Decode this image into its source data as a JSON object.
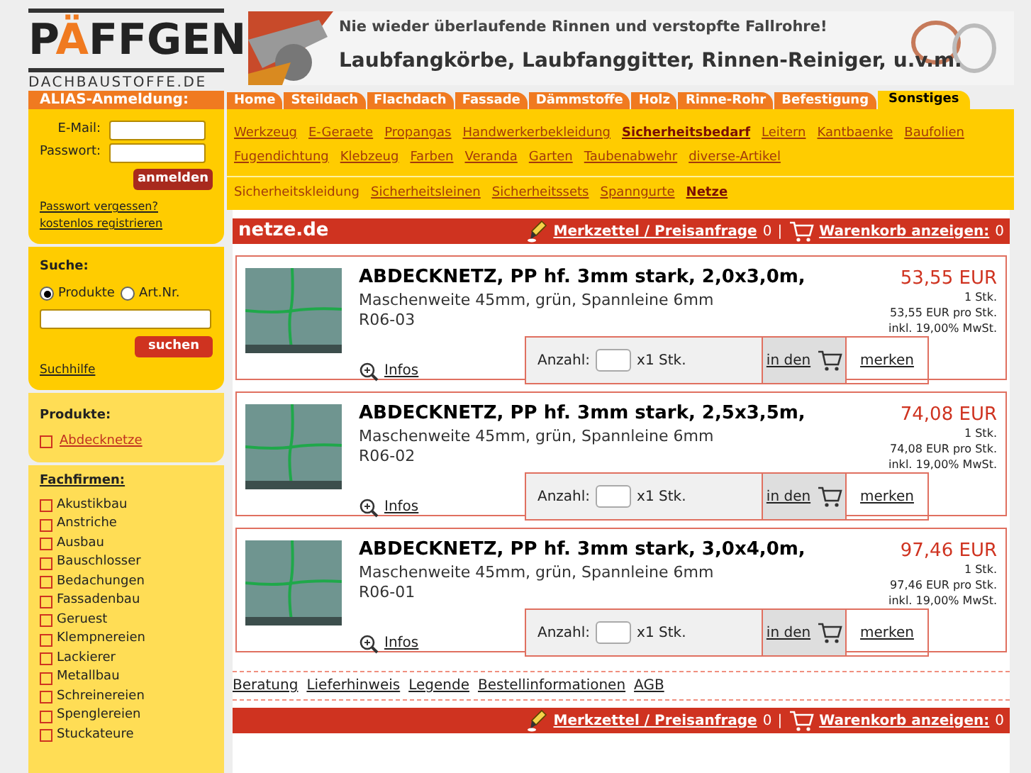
{
  "logo": {
    "before": "P",
    "accent": "Ä",
    "after": "FFGEN",
    "subtitle": "DACHBAUSTOFFE.DE"
  },
  "banner": {
    "headline": "Nie wieder überlaufende Rinnen und verstopfte Fallrohre!",
    "tagline": "Laubfangkörbe, Laubfanggitter, Rinnen-Reiniger, u.v.m."
  },
  "tabs": [
    {
      "label": "Home",
      "selected": false
    },
    {
      "label": "Steildach",
      "selected": false
    },
    {
      "label": "Flachdach",
      "selected": false
    },
    {
      "label": "Fassade",
      "selected": false
    },
    {
      "label": "Dämmstoffe",
      "selected": false
    },
    {
      "label": "Holz",
      "selected": false
    },
    {
      "label": "Rinne-Rohr",
      "selected": false
    },
    {
      "label": "Befestigung",
      "selected": false
    },
    {
      "label": "Sonstiges",
      "selected": true
    }
  ],
  "categories": [
    {
      "label": "Werkzeug",
      "selected": false
    },
    {
      "label": "E-Geraete",
      "selected": false
    },
    {
      "label": "Propangas",
      "selected": false
    },
    {
      "label": "Handwerkerbekleidung",
      "selected": false
    },
    {
      "label": "Sicherheitsbedarf",
      "selected": true
    },
    {
      "label": "Leitern",
      "selected": false
    },
    {
      "label": "Kantbaenke",
      "selected": false
    },
    {
      "label": "Baufolien",
      "selected": false
    },
    {
      "label": "Fugendichtung",
      "selected": false
    },
    {
      "label": "Klebzeug",
      "selected": false
    },
    {
      "label": "Farben",
      "selected": false
    },
    {
      "label": "Veranda",
      "selected": false
    },
    {
      "label": "Garten",
      "selected": false
    },
    {
      "label": "Taubenabwehr",
      "selected": false
    },
    {
      "label": "diverse-Artikel",
      "selected": false
    }
  ],
  "subcategories": [
    {
      "label": "Sicherheitskleidung",
      "kind": "text",
      "selected": false
    },
    {
      "label": "Sicherheitsleinen",
      "kind": "link",
      "selected": false
    },
    {
      "label": "Sicherheitssets",
      "kind": "link",
      "selected": false
    },
    {
      "label": "Spanngurte",
      "kind": "link",
      "selected": false
    },
    {
      "label": "Netze",
      "kind": "link",
      "selected": true
    }
  ],
  "login": {
    "title": "ALIAS-Anmeldung:",
    "email_label": "E-Mail:",
    "password_label": "Passwort:",
    "button": "anmelden",
    "links": [
      "Passwort vergessen?",
      "kostenlos registrieren"
    ]
  },
  "search": {
    "title": "Suche:",
    "options": [
      {
        "label": "Produkte",
        "selected": true
      },
      {
        "label": "Art.Nr.",
        "selected": false
      }
    ],
    "button": "suchen",
    "help": "Suchhilfe"
  },
  "products_box": {
    "title": "Produkte:",
    "items": [
      {
        "label": "Abdecknetze",
        "checked": false
      }
    ]
  },
  "companies": {
    "title": "Fachfirmen:",
    "items": [
      {
        "label": "Akustikbau",
        "checked": false
      },
      {
        "label": "Anstriche",
        "checked": false
      },
      {
        "label": "Ausbau",
        "checked": false
      },
      {
        "label": "Bauschlosser",
        "checked": false
      },
      {
        "label": "Bedachungen",
        "checked": false
      },
      {
        "label": "Fassadenbau",
        "checked": false
      },
      {
        "label": "Geruest",
        "checked": false
      },
      {
        "label": "Klempnereien",
        "checked": false
      },
      {
        "label": "Lackierer",
        "checked": false
      },
      {
        "label": "Metallbau",
        "checked": false
      },
      {
        "label": "Schreinereien",
        "checked": false
      },
      {
        "label": "Spenglereien",
        "checked": false
      },
      {
        "label": "Stuckateure",
        "checked": false
      }
    ]
  },
  "shop_bar": {
    "title": "netze.de",
    "wishlist": "Merkzettel / Preisanfrage",
    "wishlist_count": "0",
    "separator": "|",
    "cart": "Warenkorb anzeigen:",
    "cart_count": "0"
  },
  "products": [
    {
      "title": "ABDECKNETZ, PP hf. 3mm stark, 2,0x3,0m,",
      "description": "Maschenweite 45mm, grün, Spannleine 6mm",
      "sku": "R06-03",
      "price": "53,55 EUR",
      "unit": "1 Stk.",
      "unit_price": "53,55 EUR pro Stk.",
      "tax": "inkl. 19,00% MwSt.",
      "info": "Infos",
      "quantity_label": "Anzahl:",
      "quantity_unit": "x1 Stk.",
      "cart_button": "in den",
      "wishlist_button": "merken"
    },
    {
      "title": "ABDECKNETZ, PP hf. 3mm stark, 2,5x3,5m,",
      "description": "Maschenweite 45mm, grün, Spannleine 6mm",
      "sku": "R06-02",
      "price": "74,08 EUR",
      "unit": "1 Stk.",
      "unit_price": "74,08 EUR pro Stk.",
      "tax": "inkl. 19,00% MwSt.",
      "info": "Infos",
      "quantity_label": "Anzahl:",
      "quantity_unit": "x1 Stk.",
      "cart_button": "in den",
      "wishlist_button": "merken"
    },
    {
      "title": "ABDECKNETZ, PP hf. 3mm stark, 3,0x4,0m,",
      "description": "Maschenweite 45mm, grün, Spannleine 6mm",
      "sku": "R06-01",
      "price": "97,46 EUR",
      "unit": "1 Stk.",
      "unit_price": "97,46 EUR pro Stk.",
      "tax": "inkl. 19,00% MwSt.",
      "info": "Infos",
      "quantity_label": "Anzahl:",
      "quantity_unit": "x1 Stk.",
      "cart_button": "in den",
      "wishlist_button": "merken"
    }
  ],
  "footer_links": [
    "Beratung",
    "Lieferhinweis",
    "Legende",
    "Bestellinformationen",
    "AGB"
  ],
  "footer_bar": {
    "wishlist": "Merkzettel / Preisanfrage",
    "wishlist_count": "0",
    "separator": "|",
    "cart": "Warenkorb anzeigen:",
    "cart_count": "0"
  }
}
